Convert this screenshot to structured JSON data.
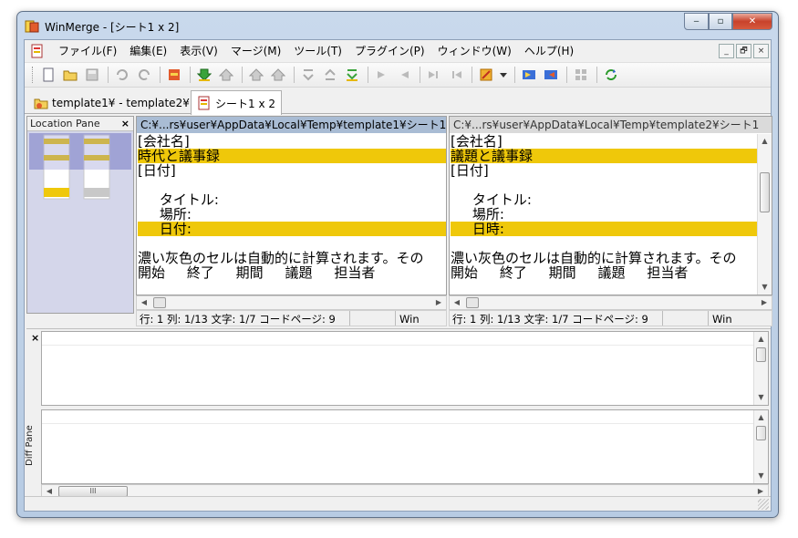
{
  "window": {
    "title": "WinMerge - [シート1 x 2]",
    "minimize": "‒",
    "maximize": "▫",
    "close": "✕"
  },
  "menu": {
    "items": [
      "ファイル(F)",
      "編集(E)",
      "表示(V)",
      "マージ(M)",
      "ツール(T)",
      "プラグイン(P)",
      "ウィンドウ(W)",
      "ヘルプ(H)"
    ],
    "mdi_min": "_",
    "mdi_restore": "🗗",
    "mdi_close": "×"
  },
  "tabs": [
    {
      "label": "template1¥ - template2¥",
      "active": false
    },
    {
      "label": "シート1 x 2",
      "active": true
    }
  ],
  "location_pane": {
    "title": "Location Pane",
    "close": "×"
  },
  "left_pane": {
    "path": "C:¥...rs¥user¥AppData¥Local¥Temp¥template1¥シート1",
    "lines": [
      {
        "text": "[会社名]",
        "hl": false
      },
      {
        "text": "時代と議事録",
        "hl": true
      },
      {
        "text": "[日付]",
        "hl": false
      },
      {
        "text": "",
        "hl": false
      },
      {
        "text": "     タイトル:",
        "hl": false
      },
      {
        "text": "     場所:",
        "hl": false
      },
      {
        "text": "     日付:",
        "hl": true
      },
      {
        "text": "",
        "hl": false
      },
      {
        "text": "濃い灰色のセルは自動的に計算されます。その",
        "hl": false
      },
      {
        "text": "開始     終了     期間     議題     担当者",
        "hl": false
      }
    ],
    "status_pos": "行: 1  列: 1/13  文字: 1/7  コードページ: 9",
    "status_enc": "Win"
  },
  "right_pane": {
    "path": "C:¥...rs¥user¥AppData¥Local¥Temp¥template2¥シート1",
    "lines": [
      {
        "text": "[会社名]",
        "hl": false
      },
      {
        "text": "議題と議事録",
        "hl": true
      },
      {
        "text": "[日付]",
        "hl": false
      },
      {
        "text": "",
        "hl": false
      },
      {
        "text": "     タイトル:",
        "hl": false
      },
      {
        "text": "     場所:",
        "hl": false
      },
      {
        "text": "     日時:",
        "hl": true
      },
      {
        "text": "",
        "hl": false
      },
      {
        "text": "濃い灰色のセルは自動的に計算されます。その",
        "hl": false
      },
      {
        "text": "開始     終了     期間     議題     担当者",
        "hl": false
      }
    ],
    "status_pos": "行: 1  列: 1/13  文字: 1/7  コードページ: 9",
    "status_enc": "Win"
  },
  "diff_pane": {
    "label": "Diff Pane",
    "close": "×",
    "scroll_grip": "III"
  },
  "colors": {
    "diff_highlight": "#efc80a",
    "active_header": "#a9bcd4",
    "location_bg": "#d4d6ea"
  }
}
